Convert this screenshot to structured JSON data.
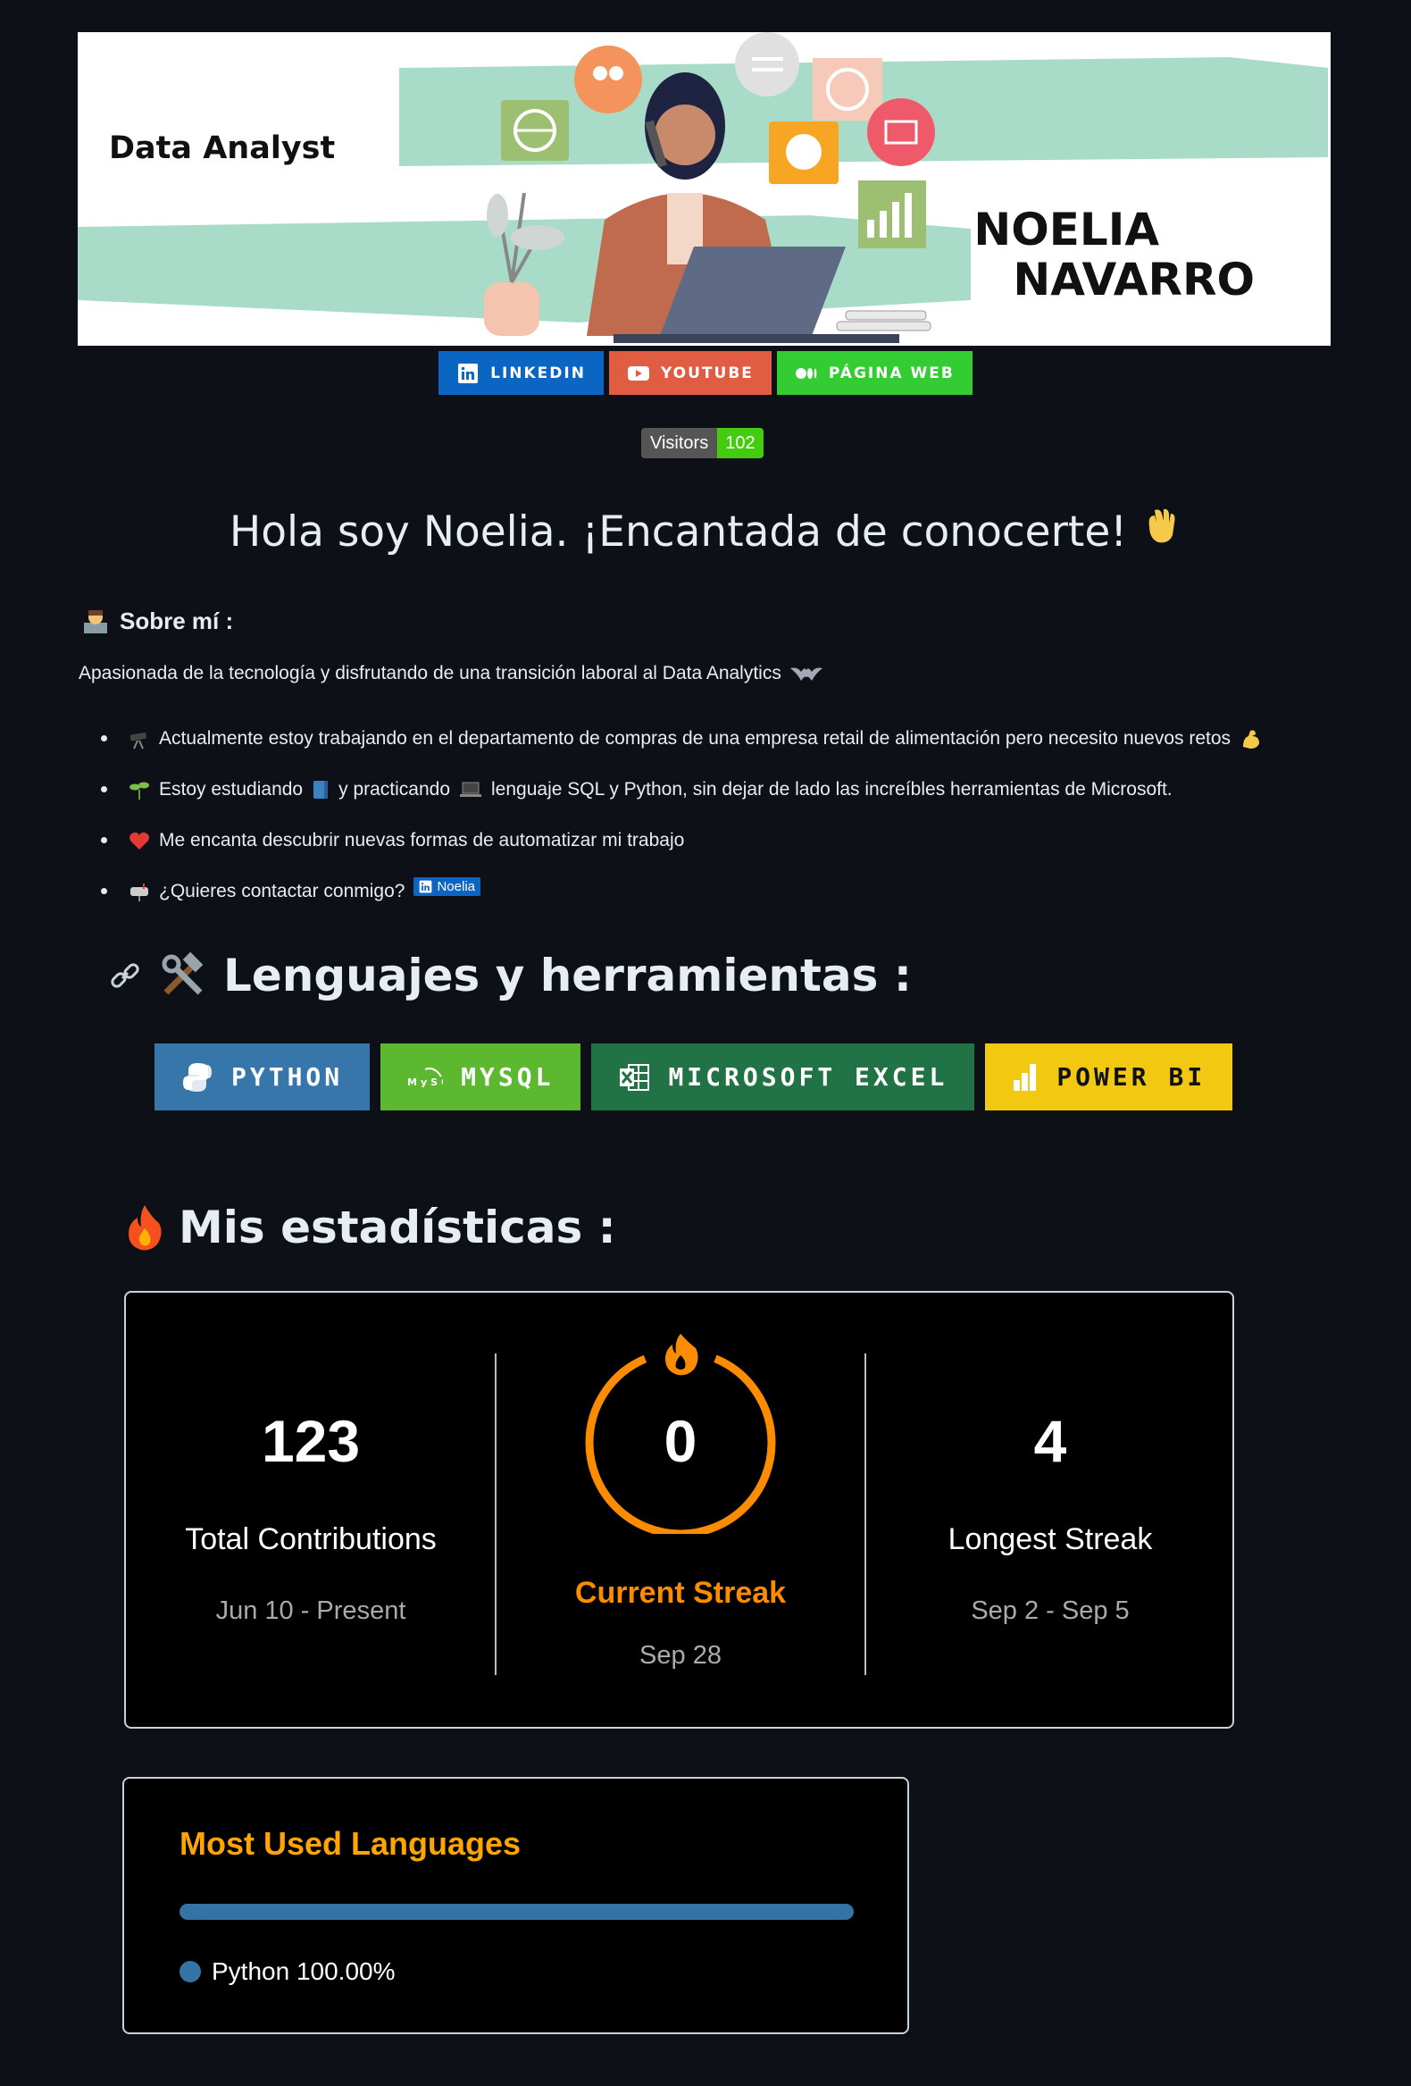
{
  "banner": {
    "role": "Data Analyst",
    "name_line1": "NOELIA",
    "name_line2": "NAVARRO"
  },
  "social": [
    {
      "label": "LINKEDIN",
      "color": "#0a66c2",
      "icon": "linkedin-icon"
    },
    {
      "label": "YOUTUBE",
      "color": "#e05d44",
      "icon": "youtube-icon"
    },
    {
      "label": "PÁGINA WEB",
      "color": "#33cc33",
      "icon": "medium-icon"
    }
  ],
  "visitors": {
    "label": "Visitors",
    "count": "102"
  },
  "headline": "Hola soy Noelia. ¡Encantada de conocerte!",
  "about": {
    "title": "Sobre mí :",
    "intro": "Apasionada de la tecnología y disfrutando de una transición laboral al Data Analytics",
    "items": [
      {
        "pre": "Actualmente estoy trabajando en el departamento de compras de una empresa retail de alimentación pero necesito nuevos retos"
      },
      {
        "pre": "Estoy estudiando",
        "mid": "y practicando",
        "post": "lenguaje SQL y Python, sin dejar de lado las increíbles herramientas de Microsoft."
      },
      {
        "pre": "Me encanta descubrir nuevas formas de automatizar mi trabajo"
      },
      {
        "pre": "¿Quieres contactar conmigo?",
        "badge": "Noelia"
      }
    ]
  },
  "tools": {
    "title": "Lenguajes y herramientas :",
    "items": [
      {
        "label": "PYTHON",
        "color": "#3776ab"
      },
      {
        "label": "MYSQL",
        "color": "#5cb82e"
      },
      {
        "label": "MICROSOFT EXCEL",
        "color": "#217346"
      },
      {
        "label": "POWER BI",
        "color": "#f2c811"
      }
    ]
  },
  "stats": {
    "title": "Mis estadísticas :",
    "total": {
      "value": "123",
      "label": "Total Contributions",
      "range": "Jun 10 - Present"
    },
    "current": {
      "value": "0",
      "label": "Current Streak",
      "range": "Sep 28"
    },
    "longest": {
      "value": "4",
      "label": "Longest Streak",
      "range": "Sep 2 - Sep 5"
    },
    "accent": "#fb8c00"
  },
  "langs": {
    "title": "Most Used Languages",
    "items": [
      {
        "name": "Python 100.00%",
        "percent": 100,
        "color": "#3572a5"
      }
    ]
  }
}
